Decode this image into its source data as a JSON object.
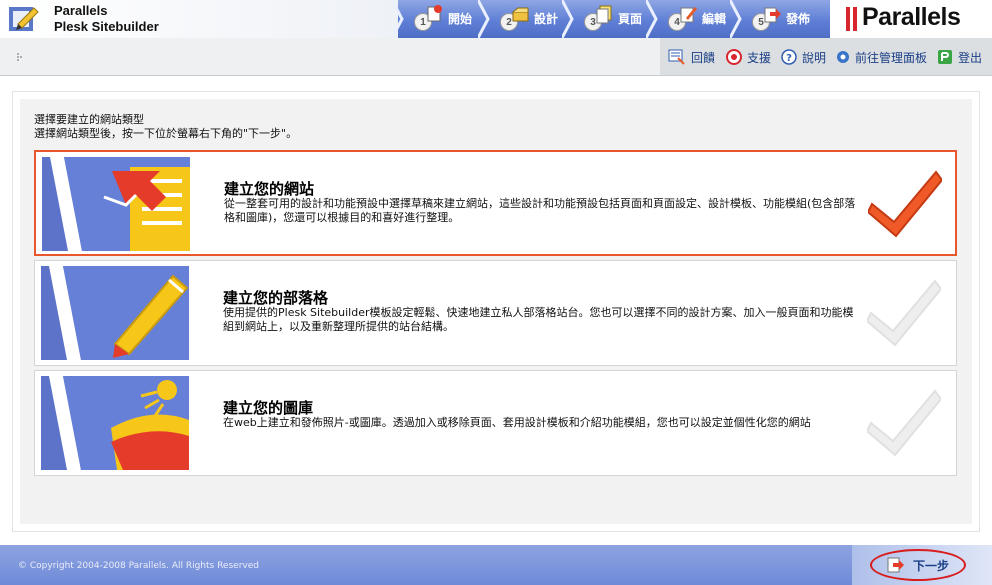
{
  "brand": {
    "line1": "Parallels",
    "line2": "Plesk Sitebuilder"
  },
  "steps": [
    {
      "num": "1",
      "label": "開始"
    },
    {
      "num": "2",
      "label": "設計"
    },
    {
      "num": "3",
      "label": "頁面"
    },
    {
      "num": "4",
      "label": "編輯"
    },
    {
      "num": "5",
      "label": "發佈"
    }
  ],
  "parallels_logo": "Parallels",
  "toolbar": {
    "feedback": "回饋",
    "support": "支援",
    "help": "說明",
    "control_panel": "前往管理面板",
    "logout": "登出"
  },
  "intro": {
    "line1": "選擇要建立的網站類型",
    "line2": "選擇網站類型後，按一下位於螢幕右下角的\"下一步\"。"
  },
  "options": [
    {
      "title": "建立您的網站",
      "desc": "從一整套可用的設計和功能預設中選擇草稿來建立網站，這些設計和功能預設包括頁面和頁面設定、設計模板、功能模組(包含部落格和圖庫)，您還可以根據目的和喜好進行整理。",
      "selected": true
    },
    {
      "title": "建立您的部落格",
      "desc": "使用提供的Plesk Sitebuilder模板設定輕鬆、快速地建立私人部落格站台。您也可以選擇不同的設計方案、加入一般頁面和功能模組到網站上，以及重新整理所提供的站台結構。",
      "selected": false
    },
    {
      "title": "建立您的圖庫",
      "desc": "在web上建立和發佈照片-或圖庫。透過加入或移除頁面、套用設計模板和介紹功能模組，您也可以設定並個性化您的網站",
      "selected": false
    }
  ],
  "footer": {
    "copyright": "© Copyright 2004-2008 Parallels. All Rights Reserved",
    "next": "下一步"
  },
  "colors": {
    "accent": "#e8582c",
    "link": "#1a3f86",
    "steps_bar": "#5f7fd6"
  }
}
